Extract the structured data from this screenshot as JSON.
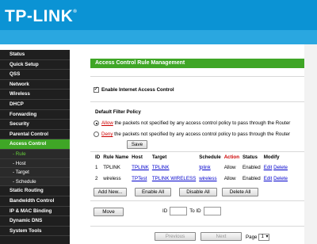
{
  "header": {
    "brand": "TP-LINK",
    "trademark": "®"
  },
  "sidebar": {
    "items": [
      {
        "label": "Status"
      },
      {
        "label": "Quick Setup"
      },
      {
        "label": "QSS"
      },
      {
        "label": "Network"
      },
      {
        "label": "Wireless"
      },
      {
        "label": "DHCP"
      },
      {
        "label": "Forwarding"
      },
      {
        "label": "Security"
      },
      {
        "label": "Parental Control"
      },
      {
        "label": "Access Control"
      }
    ],
    "subitems": [
      {
        "label": "- Rule"
      },
      {
        "label": "- Host"
      },
      {
        "label": "- Target"
      },
      {
        "label": "- Schedule"
      }
    ],
    "items_after": [
      {
        "label": "Static Routing"
      },
      {
        "label": "Bandwidth Control"
      },
      {
        "label": "IP & MAC Binding"
      },
      {
        "label": "Dynamic DNS"
      },
      {
        "label": "System Tools"
      }
    ]
  },
  "main": {
    "title": "Access Control Rule Management",
    "enable_label": "Enable Internet Access Control",
    "enable_checked": true,
    "policy_label": "Default Filter Policy",
    "allow": {
      "prefix_red": "Allow",
      "text": " the packets not specified by any access control policy to pass through the Router"
    },
    "deny": {
      "prefix_red": "Deny",
      "text": " the packets not specified by any access control policy to pass through the Router"
    },
    "save_label": "Save",
    "table": {
      "headers": [
        "ID",
        "Rule Name",
        "Host",
        "Target",
        "Schedule",
        "Action",
        "Status",
        "Modify"
      ],
      "rows": [
        {
          "id": "1",
          "name": "TPLINK",
          "host": "TPLINK",
          "target": "TPLINK",
          "schedule": "tplink",
          "action": "Allow",
          "status": "Enabled",
          "edit": "Edit",
          "del": "Delete"
        },
        {
          "id": "2",
          "name": "wireless",
          "host": "TPTest",
          "target": "TPLINK WIRELESS",
          "schedule": "wireless",
          "action": "Allow",
          "status": "Enabled",
          "edit": "Edit",
          "del": "Delete"
        }
      ]
    },
    "buttons": {
      "add": "Add New...",
      "enable_all": "Enable All",
      "disable_all": "Disable All",
      "delete_all": "Delete All",
      "move": "Move"
    },
    "move_row": {
      "id_label": "ID",
      "to_id_label": "To ID"
    },
    "pager": {
      "previous": "Previous",
      "next": "Next",
      "page_label": "Page",
      "page_value": "1"
    }
  },
  "colors": {
    "header_blue": "#0b93d4",
    "accent_green": "#3fa626",
    "sidebar_dark": "#1f1f1f"
  }
}
